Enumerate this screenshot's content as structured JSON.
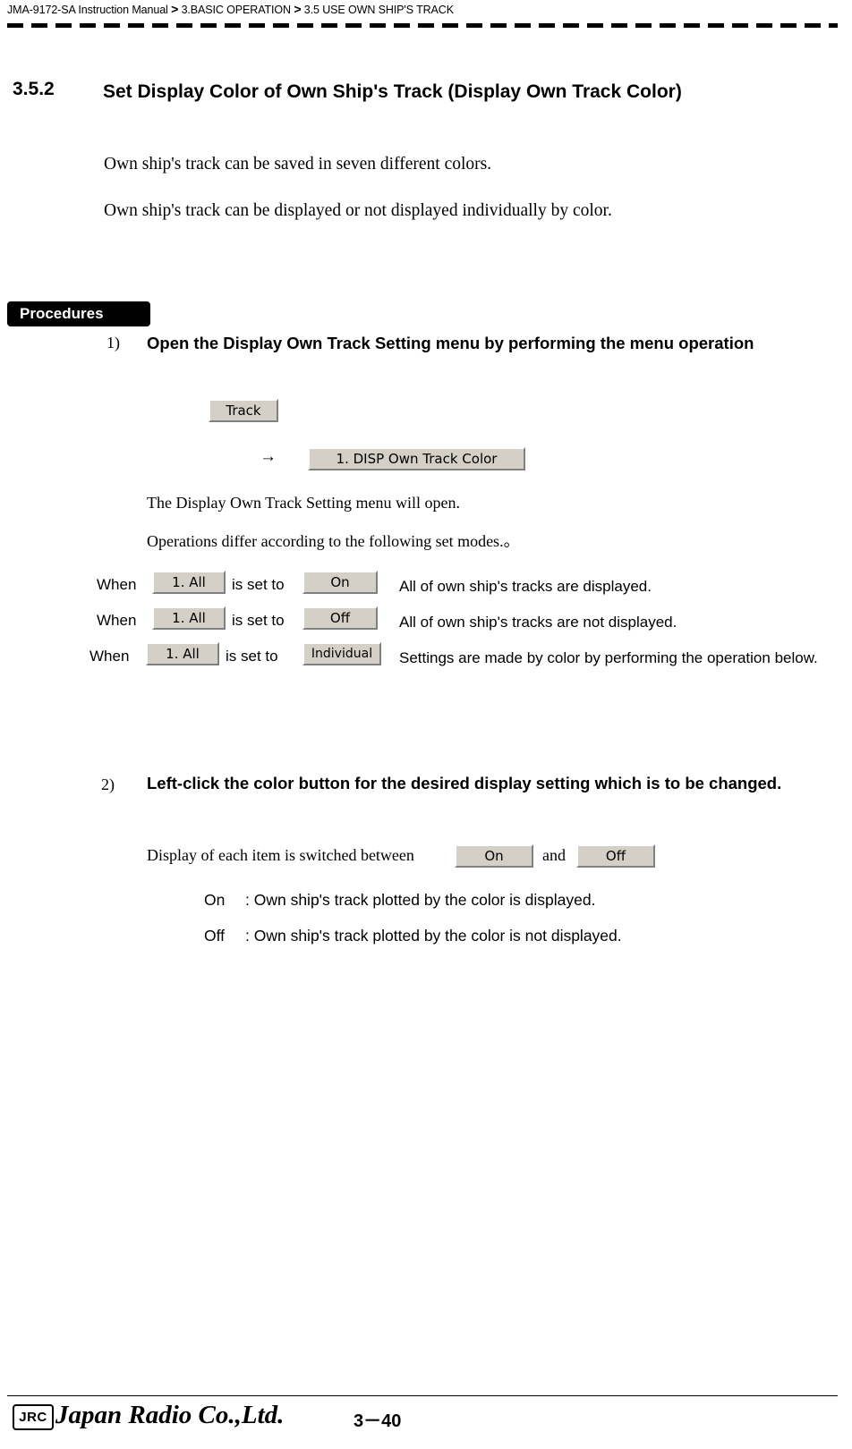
{
  "header": {
    "manual": "JMA-9172-SA Instruction Manual",
    "sep": ">",
    "chapter": "3.BASIC OPERATION",
    "section": "3.5  USE OWN SHIP'S TRACK"
  },
  "section": {
    "number": "3.5.2",
    "title": "Set Display Color of Own Ship's Track (Display Own Track Color)",
    "paragraph_1": "Own ship's track can be saved in seven different colors.",
    "paragraph_2": "Own ship's track can be displayed or not displayed individually by color."
  },
  "procedures": {
    "tag": "Procedures",
    "step1": {
      "number": "1)",
      "title": "Open the Display Own Track Setting menu by performing the menu operation",
      "chip_track": "Track",
      "arrow": "→",
      "chip_disp_own_track_color": "1. DISP Own Track Color",
      "note_1": "The Display Own Track Setting menu will open.",
      "note_2": "Operations differ according to the following set modes.。",
      "rows": [
        {
          "when": "When",
          "chip_mode": "1. All",
          "is_set_to": "is set to",
          "chip_value": "On",
          "description": "All of own ship's tracks are displayed."
        },
        {
          "when": "When",
          "chip_mode": "1. All",
          "is_set_to": "is set to",
          "chip_value": "Off",
          "description": "All of own ship's tracks are not displayed."
        },
        {
          "when": "When",
          "chip_mode": "1. All",
          "is_set_to": "is set to",
          "chip_value": "Individual",
          "description": "Settings are made by color by performing the operation below."
        }
      ]
    },
    "step2": {
      "number": "2)",
      "title": "Left-click the color button for the desired display setting which is to be changed.",
      "switch_text": "Display of each item is switched between",
      "chip_on": "On",
      "and": "and",
      "chip_off": "Off",
      "bullets": [
        {
          "label": "On",
          "text": ": Own ship's track plotted by the color is displayed."
        },
        {
          "label": "Off",
          "text": ": Own ship's track plotted by the color is not displayed."
        }
      ]
    }
  },
  "footer": {
    "logo_box": "JRC",
    "company": "Japan Radio Co.,Ltd.",
    "page": "3－40"
  }
}
